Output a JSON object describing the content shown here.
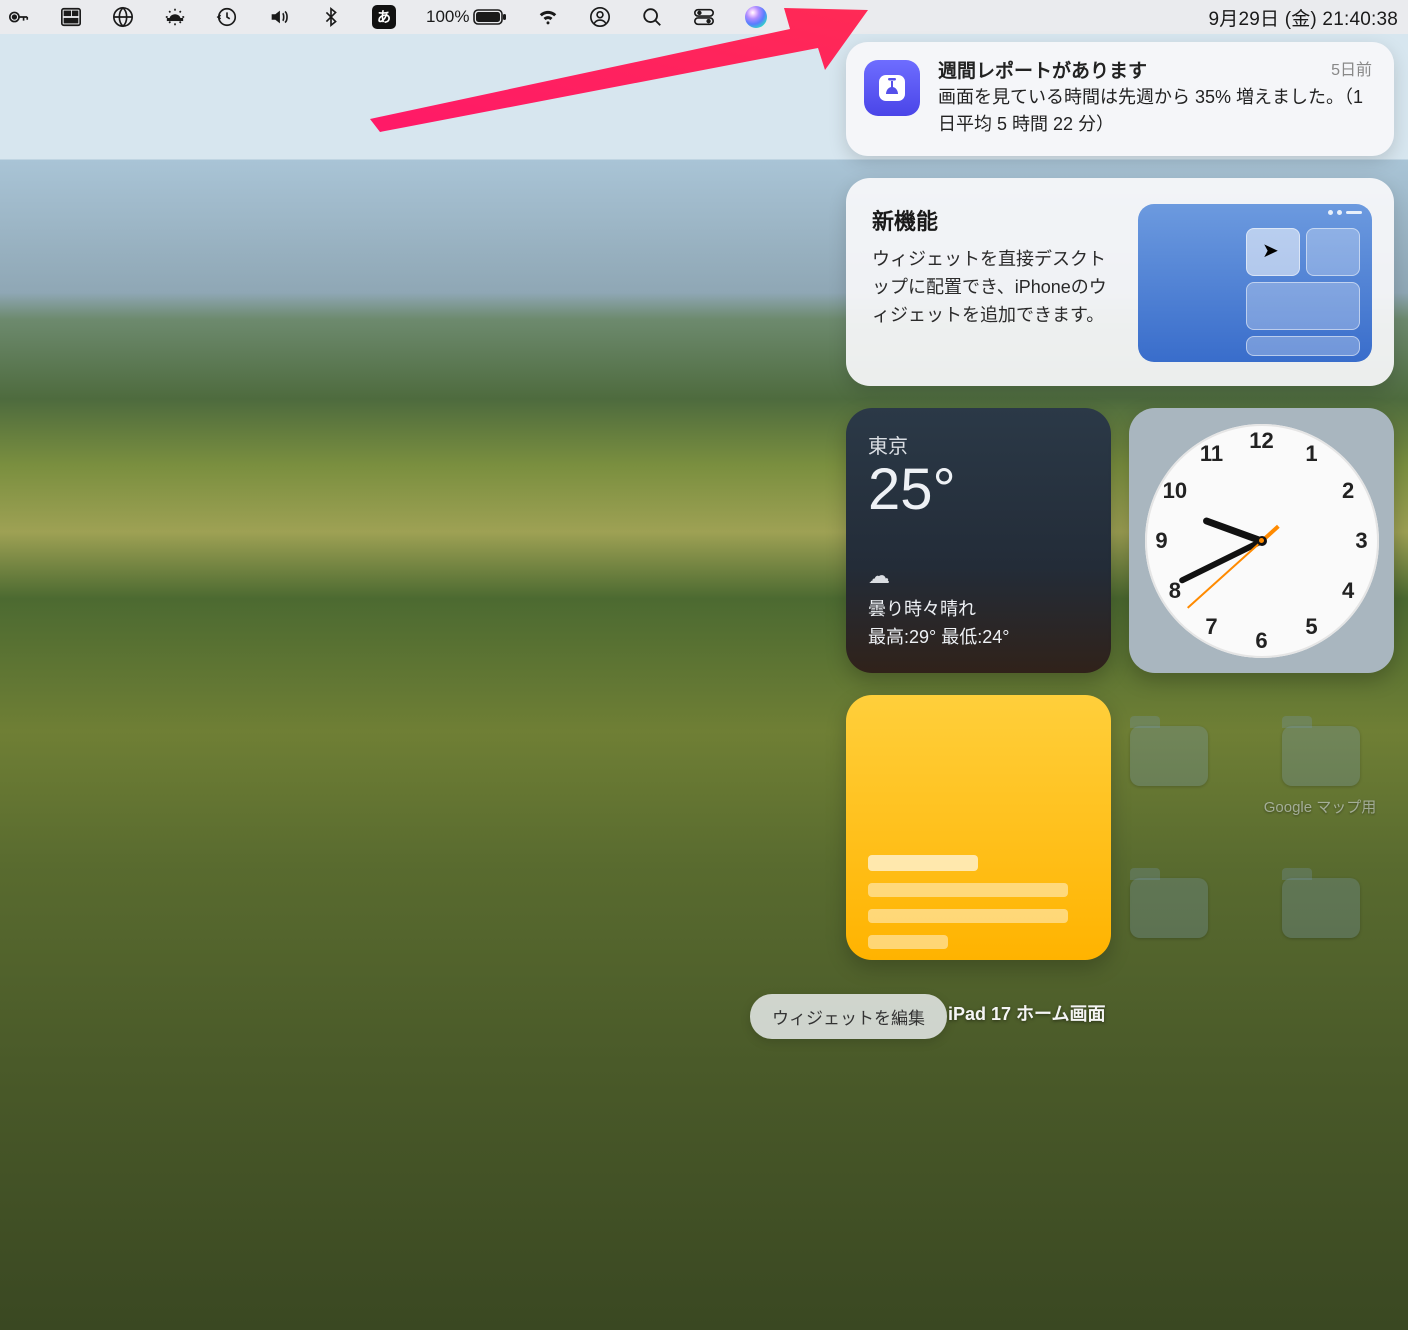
{
  "menubar": {
    "battery_pct": "100%",
    "ime_label": "あ",
    "date_time": "9月29日 (金)  21:40:38"
  },
  "notification": {
    "title": "週間レポートがあります",
    "body": "画面を見ている時間は先週から 35% 増えました。（1日平均 5 時間 22 分）",
    "when": "5日前"
  },
  "tip": {
    "heading": "新機能",
    "body": "ウィジェットを直接デスクトップに配置でき、iPhoneのウィジェットを追加できます。"
  },
  "weather": {
    "city": "東京",
    "temp": "25°",
    "condition": "曇り時々晴れ",
    "hilo": "最高:29° 最低:24°"
  },
  "clock": {
    "hour": 21,
    "minute": 40,
    "second": 38
  },
  "controls": {
    "edit_widgets": "ウィジェットを編集"
  },
  "desktop": {
    "bottom_label": "iPad 17 ホーム画面",
    "folder2_label": "Google マップ用"
  }
}
